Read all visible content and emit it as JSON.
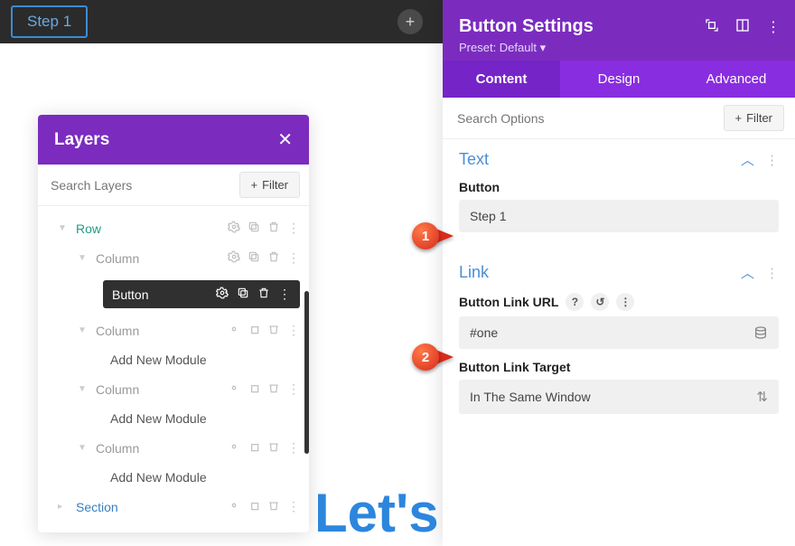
{
  "topbar": {
    "breadcrumb": "Step 1"
  },
  "layers": {
    "title": "Layers",
    "search_placeholder": "Search Layers",
    "filter_label": "Filter",
    "items": {
      "row": "Row",
      "column": "Column",
      "button": "Button",
      "add_module": "Add New Module",
      "section": "Section"
    }
  },
  "settings": {
    "title": "Button Settings",
    "preset": "Preset: Default",
    "tabs": {
      "content": "Content",
      "design": "Design",
      "advanced": "Advanced"
    },
    "search_placeholder": "Search Options",
    "filter_label": "Filter",
    "sections": {
      "text": {
        "heading": "Text",
        "button_label": "Button",
        "button_value": "Step 1"
      },
      "link": {
        "heading": "Link",
        "url_label": "Button Link URL",
        "url_value": "#one",
        "target_label": "Button Link Target",
        "target_value": "In The Same Window"
      }
    }
  },
  "markers": {
    "m1": "1",
    "m2": "2"
  },
  "bigtext": "Let's"
}
